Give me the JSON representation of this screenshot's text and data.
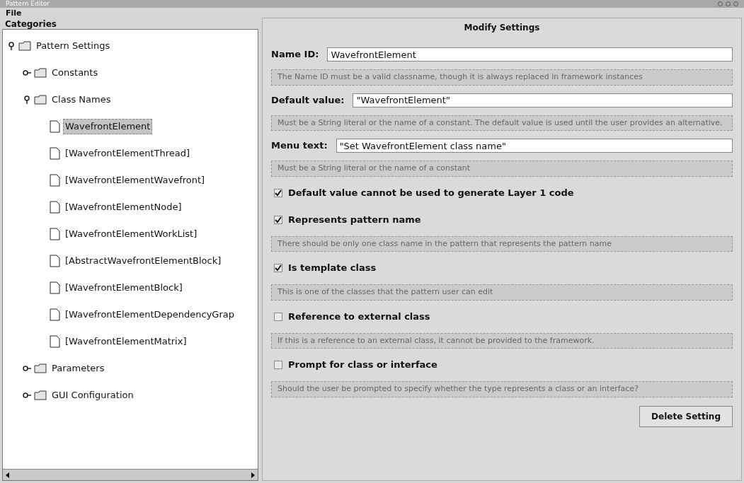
{
  "window": {
    "title": "Pattern Editor"
  },
  "menu": [
    "File"
  ],
  "categories": {
    "title": "Categories",
    "tree": [
      {
        "label": "Pattern Settings",
        "kind": "folder",
        "expanded": true,
        "selected": false,
        "children": [
          {
            "label": "Constants",
            "kind": "folder",
            "expanded": false,
            "selected": false
          },
          {
            "label": "Class Names",
            "kind": "folder",
            "expanded": true,
            "selected": false,
            "children": [
              {
                "label": "WavefrontElement",
                "kind": "file",
                "selected": true
              },
              {
                "label": "[WavefrontElementThread]",
                "kind": "file",
                "selected": false
              },
              {
                "label": "[WavefrontElementWavefront]",
                "kind": "file",
                "selected": false
              },
              {
                "label": "[WavefrontElementNode]",
                "kind": "file",
                "selected": false
              },
              {
                "label": "[WavefrontElementWorkList]",
                "kind": "file",
                "selected": false
              },
              {
                "label": "[AbstractWavefrontElementBlock]",
                "kind": "file",
                "selected": false
              },
              {
                "label": "[WavefrontElementBlock]",
                "kind": "file",
                "selected": false
              },
              {
                "label": "[WavefrontElementDependencyGrap",
                "kind": "file",
                "selected": false
              },
              {
                "label": "[WavefrontElementMatrix]",
                "kind": "file",
                "selected": false
              }
            ]
          },
          {
            "label": "Parameters",
            "kind": "folder",
            "expanded": false,
            "selected": false
          },
          {
            "label": "GUI Configuration",
            "kind": "folder",
            "expanded": false,
            "selected": false
          }
        ]
      }
    ]
  },
  "settings": {
    "title": "Modify Settings",
    "items": [
      {
        "kind": "field",
        "label": "Name ID:",
        "value": "WavefrontElement"
      },
      {
        "kind": "note",
        "text": "The Name ID must be a valid classname, though it is always replaced in framework instances"
      },
      {
        "kind": "field",
        "label": "Default value:",
        "value": "\"WavefrontElement\""
      },
      {
        "kind": "note",
        "text": "Must be a String literal or the name of a constant. The default value is used until the user provides an alternative."
      },
      {
        "kind": "field",
        "label": "Menu text:",
        "value": "\"Set WavefrontElement class name\""
      },
      {
        "kind": "note",
        "text": "Must be a String literal or the name of a constant"
      },
      {
        "kind": "checkbox",
        "label": "Default value cannot be used to generate Layer 1 code",
        "checked": true
      },
      {
        "kind": "checkbox",
        "label": "Represents pattern name",
        "checked": true
      },
      {
        "kind": "note",
        "text": "There should be only one class name in the pattern that represents the pattern name"
      },
      {
        "kind": "checkbox",
        "label": "Is template class",
        "checked": true
      },
      {
        "kind": "note",
        "text": "This is one of the classes that the pattern user can edit"
      },
      {
        "kind": "checkbox",
        "label": "Reference to external class",
        "checked": false
      },
      {
        "kind": "note",
        "text": "If this is a reference to an external class, it cannot be provided to the framework."
      },
      {
        "kind": "checkbox",
        "label": "Prompt for class or interface",
        "checked": false
      },
      {
        "kind": "note",
        "text": "Should the user be prompted to specify whether the type represents a class or an interface?"
      }
    ],
    "button": "Delete Setting"
  }
}
